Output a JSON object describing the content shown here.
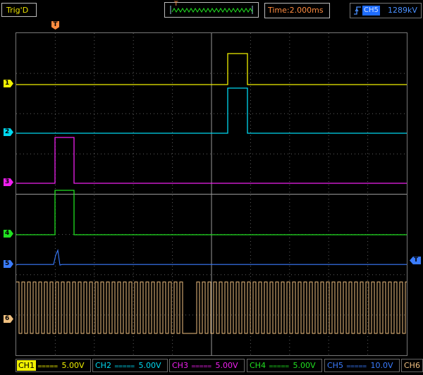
{
  "top": {
    "trigger_status": "Trig'D",
    "timebase_marker": "T",
    "time_label": "Time:2.000ms",
    "trigger_source": "CH5",
    "trigger_level": "1289kV",
    "trigger_edge_icon": "rising-edge-icon"
  },
  "markers": {
    "trigger_pos": "T",
    "trigger_level_right": "T"
  },
  "channels": [
    {
      "tag": "CH1",
      "coupling": "=====",
      "scale": "5.00V",
      "color": "#f0f000",
      "marker": "1"
    },
    {
      "tag": "CH2",
      "coupling": "=====",
      "scale": "5.00V",
      "color": "#00d8f0",
      "marker": "2"
    },
    {
      "tag": "CH3",
      "coupling": "=====",
      "scale": "5.00V",
      "color": "#f020f0",
      "marker": "3"
    },
    {
      "tag": "CH4",
      "coupling": "=====",
      "scale": "5.00V",
      "color": "#20e020",
      "marker": "4"
    },
    {
      "tag": "CH5",
      "coupling": "=====",
      "scale": "10.0V",
      "color": "#3a7cff",
      "marker": "5"
    },
    {
      "tag": "CH6",
      "coupling": "",
      "scale": "",
      "color": "#f0c080",
      "marker": "6"
    }
  ],
  "colors": {
    "ch1": "#f0f000",
    "ch2": "#00d8f0",
    "ch3": "#f020f0",
    "ch4": "#20e020",
    "ch5": "#3a7cff",
    "ch6": "#f0c080",
    "grid": "#606060",
    "frame": "#777777",
    "accent": "#ff8c40"
  }
}
